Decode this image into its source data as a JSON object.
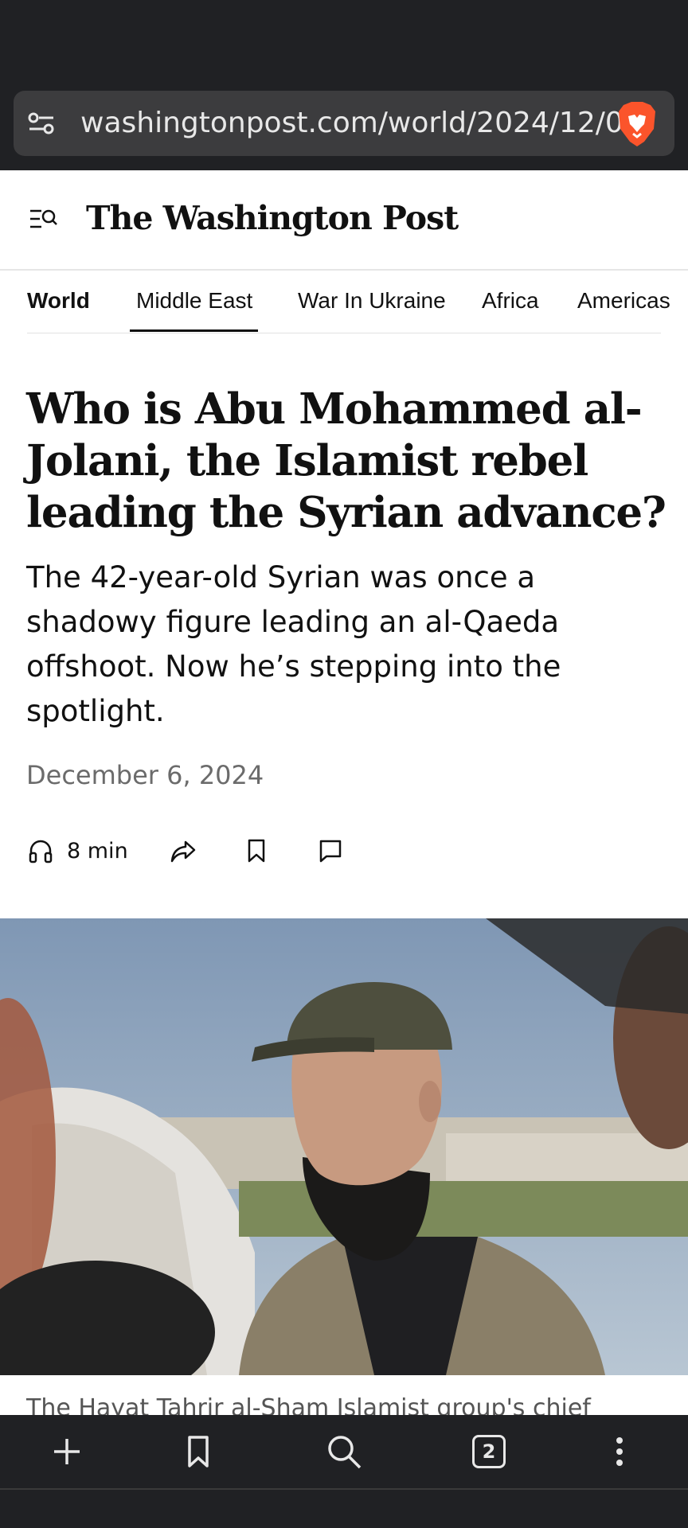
{
  "browser": {
    "url": "washingtonpost.com/world/2024/12/0",
    "tab_count": "2",
    "icons": [
      "tune-icon",
      "brave-lion-icon",
      "plus-icon",
      "bookmark-icon",
      "search-icon",
      "tabs-icon",
      "more-vert-icon"
    ]
  },
  "header": {
    "logo_text": "The Washington Post"
  },
  "section_nav": {
    "items": [
      {
        "label": "World"
      },
      {
        "label": "Middle East"
      },
      {
        "label": "War In Ukraine"
      },
      {
        "label": "Africa"
      },
      {
        "label": "Americas"
      }
    ],
    "selected": "Middle East"
  },
  "article": {
    "headline": "Who is Abu Mohammed al-Jolani, the Islamist rebel leading the Syrian advance?",
    "dek": "The 42-year-old Syrian was once a shadowy figure leading an al-Qaeda offshoot. Now he’s stepping into the spotlight.",
    "date": "December 6, 2024",
    "listen_duration": "8 min",
    "caption_partial": "The Hayat Tahrir al-Sham Islamist group's chief"
  },
  "colors": {
    "chrome": "#202124",
    "urlbar": "#3c3c3e",
    "brave_orange": "#fb542b",
    "text": "#111111",
    "muted": "#6b6b6b"
  }
}
